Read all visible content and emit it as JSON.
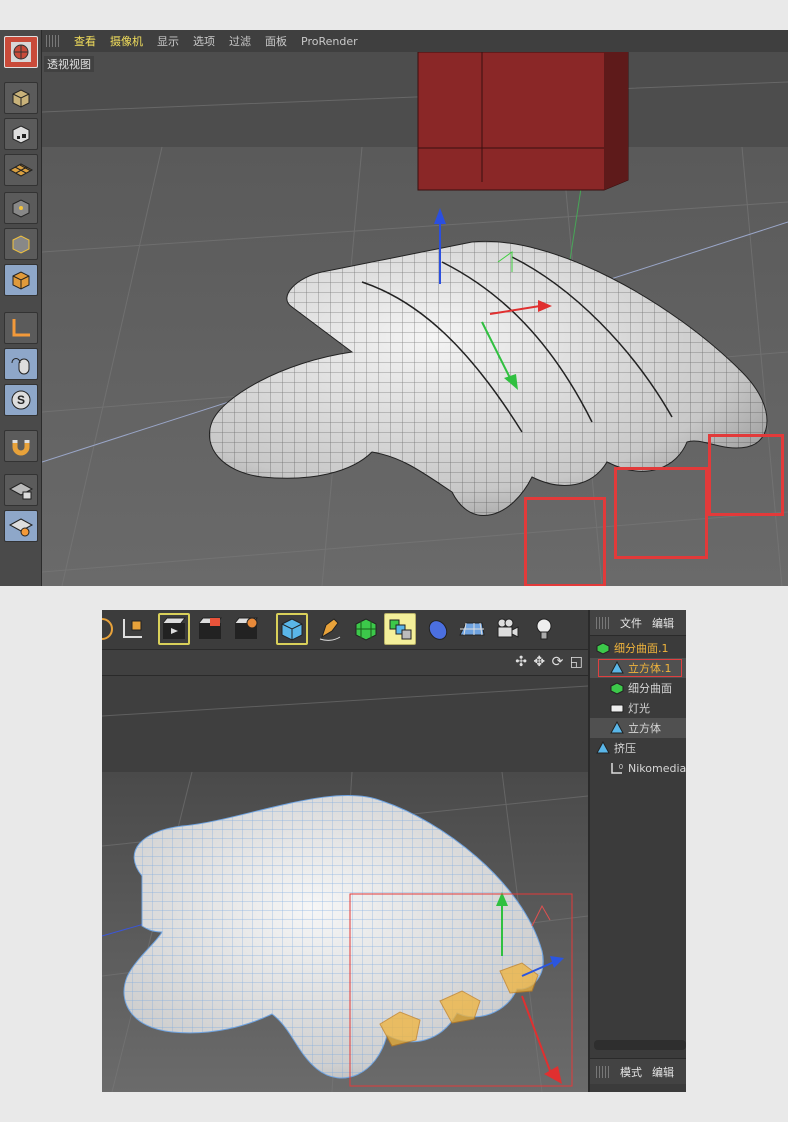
{
  "top_view": {
    "menu": [
      "查看",
      "摄像机",
      "显示",
      "选项",
      "过滤",
      "面板",
      "ProRender"
    ],
    "viewport_label": "透视视图",
    "toolbar_icons": [
      "viewport-icon",
      "cube-edit-icon",
      "checker-cube-icon",
      "grid-plane-icon",
      "point-mode-icon",
      "edge-mode-icon",
      "polygon-mode-icon",
      "axis-icon",
      "mouse-tweak-icon",
      "snap-s-icon",
      "magnet-icon",
      "lock-grid-icon",
      "workplane-icon"
    ]
  },
  "bottom_view": {
    "toolbar_icons": [
      "undo-icon",
      "axis-icon",
      "render-view-icon",
      "render-picture-icon",
      "render-settings-icon",
      "cube-icon",
      "pen-icon",
      "subdivision-icon",
      "array-icon",
      "deformer-icon",
      "floor-icon",
      "camera-icon",
      "light-icon"
    ],
    "nav_glyphs": "✣ ✥ ⟳ ◱",
    "object_manager": {
      "tabs": [
        "文件",
        "编辑"
      ],
      "objects": [
        {
          "name": "细分曲面.1",
          "icon": "subdivision-icon",
          "active": true
        },
        {
          "name": "立方体.1",
          "icon": "cube-icon",
          "child": true,
          "selected": true
        },
        {
          "name": "细分曲面",
          "icon": "subdivision-icon"
        },
        {
          "name": "灯光",
          "icon": "light-icon"
        },
        {
          "name": "立方体",
          "icon": "cube-icon"
        },
        {
          "name": "挤压",
          "icon": "extrude-icon"
        },
        {
          "name": "Nikomedias",
          "icon": "null-icon"
        }
      ],
      "bottom_tabs": [
        "模式",
        "编辑"
      ]
    }
  },
  "colors": {
    "accent_yellow": "#f3df5c",
    "highlight_red": "#e23a3a",
    "active_orange": "#f0b43c",
    "wire_blue": "#6fa3e0"
  }
}
